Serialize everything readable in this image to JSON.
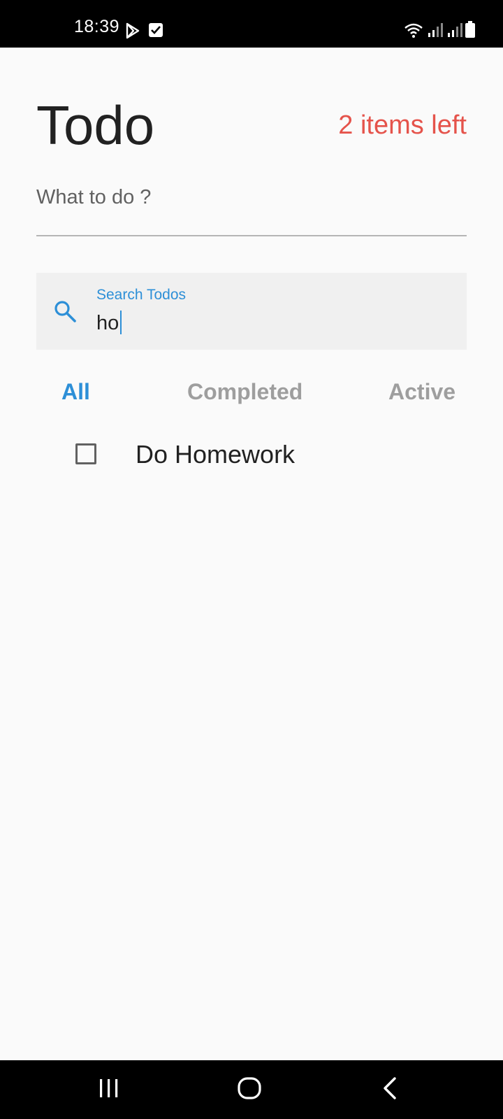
{
  "status_bar": {
    "time": "18:39",
    "icons": [
      "play-store-icon",
      "check-square-icon",
      "wifi-icon",
      "signal-icon",
      "signal-icon",
      "battery-icon"
    ]
  },
  "header": {
    "title": "Todo",
    "items_left": "2 items left"
  },
  "new_todo": {
    "placeholder": "What to do ?",
    "value": ""
  },
  "search": {
    "label": "Search Todos",
    "value": "ho"
  },
  "filters": {
    "tabs": [
      {
        "label": "All",
        "active": true
      },
      {
        "label": "Completed",
        "active": false
      },
      {
        "label": "Active",
        "active": false
      }
    ]
  },
  "todos": [
    {
      "text": "Do Homework",
      "completed": false
    }
  ],
  "colors": {
    "accent": "#2d8fd7",
    "counter": "#e5534b",
    "inactive_tab": "#9e9e9e"
  },
  "nav_bar": {
    "buttons": [
      "recent-apps",
      "home",
      "back"
    ]
  }
}
